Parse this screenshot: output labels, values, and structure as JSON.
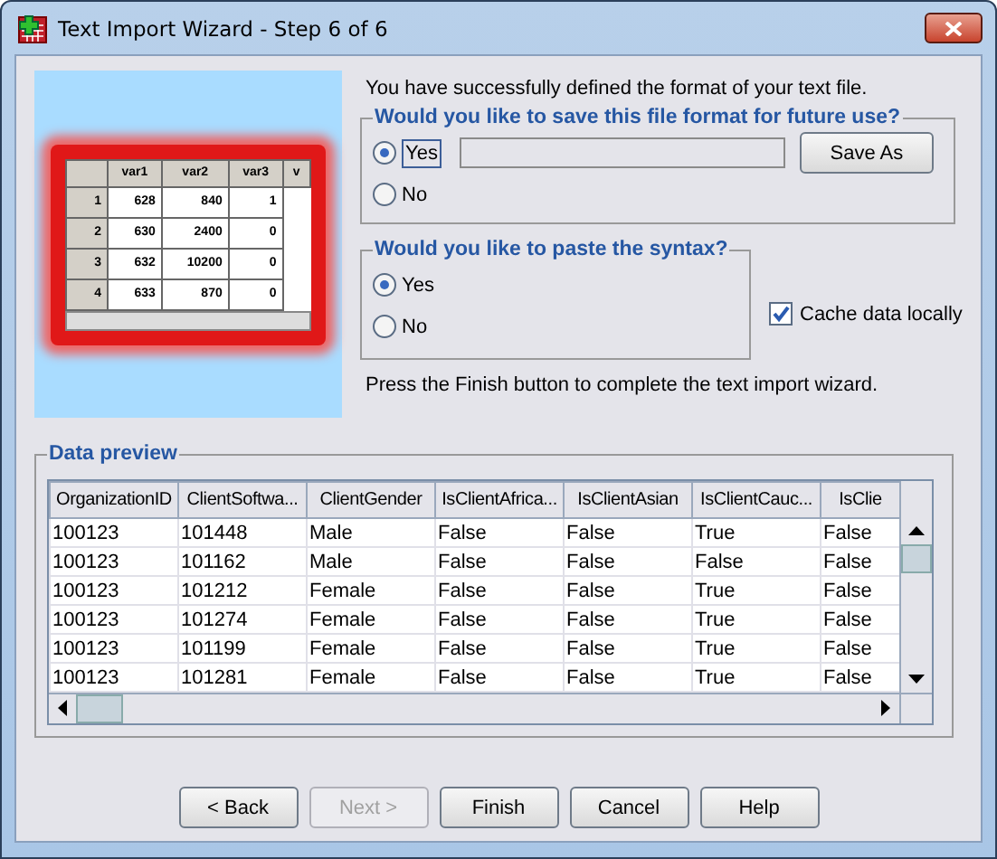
{
  "window": {
    "title": "Text Import Wizard - Step 6 of 6"
  },
  "illustration": {
    "columns": [
      "",
      "var1",
      "var2",
      "var3",
      "v"
    ],
    "rows": [
      [
        "1",
        "628",
        "840",
        "1"
      ],
      [
        "2",
        "630",
        "2400",
        "0"
      ],
      [
        "3",
        "632",
        "10200",
        "0"
      ],
      [
        "4",
        "633",
        "870",
        "0"
      ]
    ]
  },
  "intro": "You have successfully defined the format of your text file.",
  "save_format": {
    "legend": "Would you like to save this file format for future use?",
    "options": [
      {
        "label": "Yes",
        "selected": true
      },
      {
        "label": "No",
        "selected": false
      }
    ],
    "button": "Save As"
  },
  "paste_syntax": {
    "legend": "Would you like to paste the syntax?",
    "options": [
      {
        "label": "Yes",
        "selected": true
      },
      {
        "label": "No",
        "selected": false
      }
    ]
  },
  "cache": {
    "label": "Cache data locally",
    "checked": true
  },
  "finish_note": "Press the Finish button to complete the text import wizard.",
  "preview": {
    "legend": "Data preview",
    "columns": [
      "OrganizationID",
      "ClientSoftwa...",
      "ClientGender",
      "IsClientAfrica...",
      "IsClientAsian",
      "IsClientCauc...",
      "IsClie"
    ],
    "rows": [
      [
        "100123",
        "101448",
        "Male",
        "False",
        "False",
        "True",
        "False"
      ],
      [
        "100123",
        "101162",
        "Male",
        "False",
        "False",
        "False",
        "False"
      ],
      [
        "100123",
        "101212",
        "Female",
        "False",
        "False",
        "True",
        "False"
      ],
      [
        "100123",
        "101274",
        "Female",
        "False",
        "False",
        "True",
        "False"
      ],
      [
        "100123",
        "101199",
        "Female",
        "False",
        "False",
        "True",
        "False"
      ],
      [
        "100123",
        "101281",
        "Female",
        "False",
        "False",
        "True",
        "False"
      ]
    ]
  },
  "buttons": [
    {
      "label": "< Back",
      "disabled": false
    },
    {
      "label": "Next >",
      "disabled": true
    },
    {
      "label": "Finish",
      "disabled": false
    },
    {
      "label": "Cancel",
      "disabled": false
    },
    {
      "label": "Help",
      "disabled": false
    }
  ]
}
